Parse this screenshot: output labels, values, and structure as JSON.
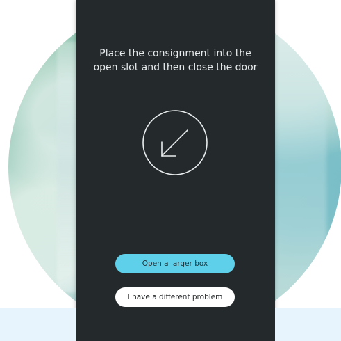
{
  "screen": {
    "instruction_line1": "Place the consignment into the",
    "instruction_line2": "open slot and then close the door",
    "icon": "arrow-down-left-circle-icon"
  },
  "buttons": {
    "primary_label": "Open a larger box",
    "secondary_label": "I have a different problem"
  },
  "colors": {
    "screen_background": "#24292c",
    "primary_button": "#5ed0ea",
    "secondary_button": "#ffffff",
    "bottom_band": "#e8f4fd"
  }
}
